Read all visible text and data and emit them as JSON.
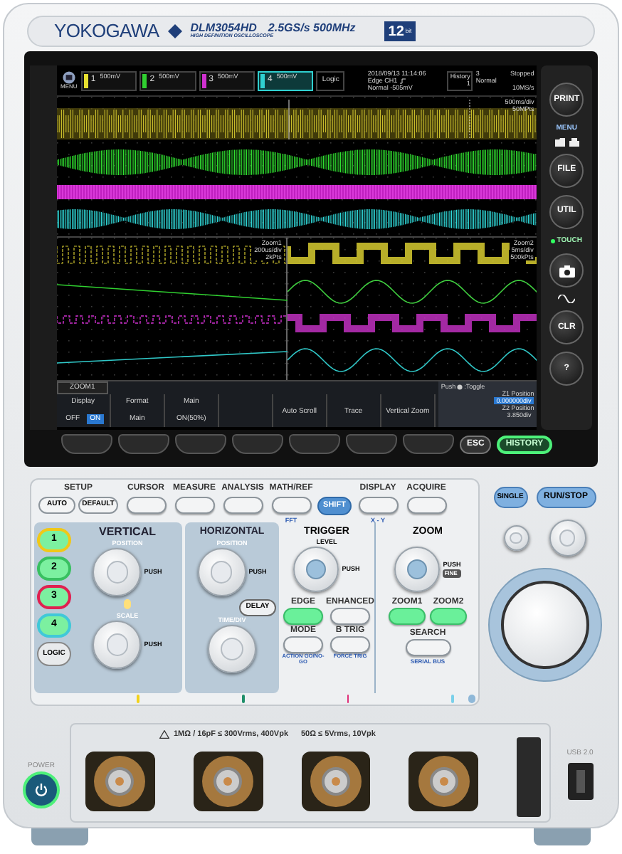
{
  "header": {
    "brand": "YOKOGAWA",
    "model": "DLM3054HD",
    "spec": "2.5GS/s 500MHz",
    "subtitle": "HIGH DEFINITION OSCILLOSCOPE",
    "badge": "12",
    "badge_unit": "bit"
  },
  "screen": {
    "menu_label": "MENU",
    "channels": [
      {
        "number": "1",
        "scale": "500mV",
        "color": "#e8e030",
        "selected": false
      },
      {
        "number": "2",
        "scale": "500mV",
        "color": "#30d030",
        "selected": false
      },
      {
        "number": "3",
        "scale": "500mV",
        "color": "#d030d0",
        "selected": false
      },
      {
        "number": "4",
        "scale": "500mV",
        "color": "#30d0d0",
        "selected": true
      }
    ],
    "logic_label": "Logic",
    "datetime": "2018/09/13 11:14:06",
    "trigger_type": "Edge CH1",
    "trigger_level": "Normal -505mV",
    "history_label": "History",
    "history_index": "1",
    "history_count": "3",
    "run_state": "Stopped",
    "trigger_mode": "Normal",
    "sample_rate": "10MS/s",
    "main_timebase": "500ms/div",
    "main_points": "50MPts",
    "zoom1": {
      "title": "Zoom1",
      "timebase": "200us/div",
      "points": "2kPts"
    },
    "zoom2": {
      "title": "Zoom2",
      "timebase": "5ms/div",
      "points": "500kPts"
    },
    "menu": {
      "title": "ZOOM1",
      "softkeys": [
        {
          "kind": "toggle",
          "label": "Display",
          "options": [
            {
              "label": "OFF",
              "selected": false
            },
            {
              "label": "ON",
              "selected": true
            }
          ]
        },
        {
          "kind": "value",
          "label": "Format",
          "value": "Main"
        },
        {
          "kind": "value",
          "label": "Main",
          "value": "ON(50%)"
        },
        {
          "kind": "empty"
        },
        {
          "kind": "action",
          "label": "Auto Scroll"
        },
        {
          "kind": "action",
          "label": "Trace"
        },
        {
          "kind": "action",
          "label": "Vertical Zoom"
        }
      ],
      "hint_before": "Push",
      "hint_after": ":Toggle",
      "positions": [
        {
          "label": "Z1 Position",
          "value": "0.000000div",
          "selected": true
        },
        {
          "label": "Z2 Position",
          "value": "3.850div",
          "selected": false
        }
      ]
    }
  },
  "side_buttons": [
    {
      "kind": "round",
      "label": "PRINT"
    },
    {
      "kind": "menu",
      "label": "MENU"
    },
    {
      "kind": "round",
      "label": "FILE"
    },
    {
      "kind": "round",
      "label": "UTIL"
    },
    {
      "kind": "indicator",
      "label": "TOUCH"
    },
    {
      "kind": "camera"
    },
    {
      "kind": "wave"
    },
    {
      "kind": "round",
      "label": "CLR"
    },
    {
      "kind": "round",
      "label": "?"
    }
  ],
  "bezel_keys": [
    {
      "label": "ESC",
      "lit": false
    },
    {
      "label": "HISTORY",
      "lit": true
    }
  ],
  "panel": {
    "setup_label": "SETUP",
    "auto": "AUTO",
    "default": "DEFAULT",
    "top_buttons": [
      {
        "kind": "plain",
        "label": "CURSOR"
      },
      {
        "kind": "plain",
        "label": "MEASURE"
      },
      {
        "kind": "plain",
        "label": "ANALYSIS"
      },
      {
        "kind": "plain",
        "label": "MATH/REF",
        "shift_label": "FFT"
      },
      {
        "kind": "shift",
        "label": "SHIFT"
      },
      {
        "kind": "plain",
        "label": "DISPLAY",
        "shift_label": "X - Y"
      },
      {
        "kind": "plain",
        "label": "ACQUIRE"
      }
    ],
    "single": "SINGLE",
    "run_stop": "RUN/STOP",
    "vertical": {
      "title": "VERTICAL",
      "position": "POSITION",
      "scale": "SCALE",
      "push": "PUSH",
      "push2": "PUSH",
      "channel_buttons": [
        {
          "label": "1",
          "color": "#f0c818"
        },
        {
          "label": "2",
          "color": "#38c060"
        },
        {
          "label": "3",
          "color": "#e02050"
        },
        {
          "label": "4",
          "color": "#40c8d8"
        }
      ],
      "logic": "LOGIC"
    },
    "horizontal": {
      "title": "HORIZONTAL",
      "position": "POSITION",
      "push": "PUSH",
      "delay": "DELAY",
      "time_div": "TIME/DIV"
    },
    "trigger": {
      "title": "TRIGGER",
      "level": "LEVEL",
      "push": "PUSH",
      "keys": [
        {
          "label": "EDGE",
          "lit": true
        },
        {
          "label": "ENHANCED",
          "lit": false
        },
        {
          "label": "MODE",
          "lit": false,
          "shift_label": "ACTION GO/NO-GO"
        },
        {
          "label": "B TRIG",
          "lit": false,
          "shift_label": "FORCE TRIG"
        }
      ]
    },
    "zoom": {
      "title": "ZOOM",
      "push": "PUSH",
      "fine": "FINE",
      "keys": [
        {
          "label": "ZOOM1",
          "lit": true
        },
        {
          "label": "ZOOM2",
          "lit": true
        }
      ],
      "search": "SEARCH",
      "serial_bus": "SERIAL BUS"
    },
    "channel_tabs": [
      {
        "color": "#f2d21a"
      },
      {
        "color": "#1f8f6a"
      },
      {
        "color": "#e0307a"
      },
      {
        "color": "#7ad0ea"
      },
      {
        "color": "#8fb8d8"
      }
    ]
  },
  "inputs": {
    "power": "POWER",
    "rating": "1MΩ / 16pF ≤ 300Vrms, 400Vpk",
    "rating2": "50Ω ≤ 5Vrms, 10Vpk",
    "usb": "USB 2.0"
  }
}
